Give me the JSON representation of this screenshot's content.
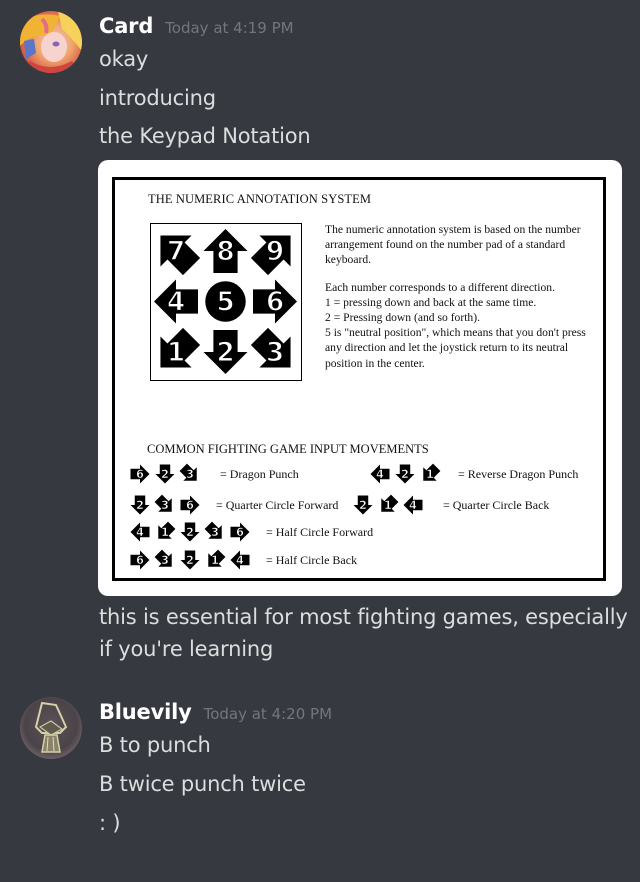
{
  "messages": [
    {
      "username": "Card",
      "timestamp": "Today at 4:19 PM",
      "avatar": "anime-character-avatar",
      "lines": [
        "okay",
        "introducing",
        "the Keypad Notation"
      ],
      "attachment": {
        "type": "image",
        "title": "THE NUMERIC ANNOTATION SYSTEM",
        "keypad": [
          "7",
          "8",
          "9",
          "4",
          "5",
          "6",
          "1",
          "2",
          "3"
        ],
        "description": [
          "The numeric annotation system is based on the number arrangement found on the number pad of a standard keyboard.",
          "Each number corresponds to a different direction.",
          "1 = pressing down and back at the same time.",
          "2 = Pressing down (and so forth).",
          "5 is \"neutral position\", which means that you don't press any direction and let the joystick return to its neutral position in the center."
        ],
        "moves_title": "COMMON FIGHTING GAME INPUT MOVEMENTS",
        "moves": [
          {
            "inputs": [
              "6",
              "2",
              "3"
            ],
            "label": "= Dragon Punch"
          },
          {
            "inputs": [
              "4",
              "2",
              "1"
            ],
            "label": "= Reverse Dragon Punch"
          },
          {
            "inputs": [
              "2",
              "3",
              "6"
            ],
            "label": "= Quarter Circle Forward"
          },
          {
            "inputs": [
              "2",
              "1",
              "4"
            ],
            "label": "= Quarter Circle Back"
          },
          {
            "inputs": [
              "4",
              "1",
              "2",
              "3",
              "6"
            ],
            "label": "= Half Circle Forward"
          },
          {
            "inputs": [
              "6",
              "3",
              "2",
              "1",
              "4"
            ],
            "label": "= Half Circle Back"
          }
        ]
      },
      "lines_after": [
        "this is essential for most fighting games, especially",
        "if you're learning"
      ]
    },
    {
      "username": "Bluevily",
      "timestamp": "Today at 4:20 PM",
      "avatar": "hooded-figure-avatar",
      "lines": [
        "B to punch",
        "B twice punch twice",
        ": )"
      ]
    }
  ],
  "colors": {
    "background": "#36393f",
    "username": "#ffffff",
    "timestamp": "#72767d",
    "message_text": "#dcddde"
  }
}
